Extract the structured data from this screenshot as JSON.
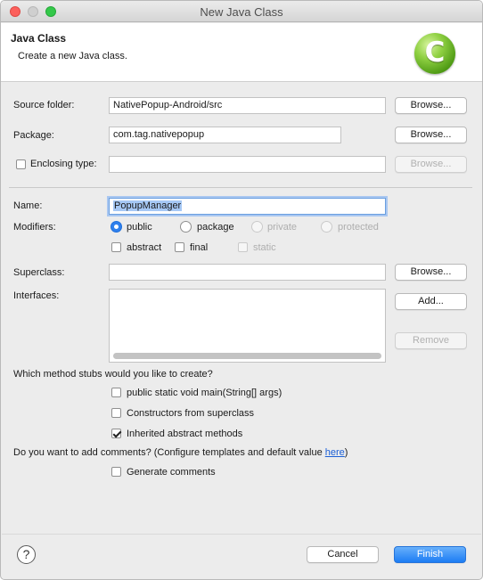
{
  "window": {
    "title": "New Java Class"
  },
  "header": {
    "title": "Java Class",
    "description": "Create a new Java class.",
    "logo_letter": "C"
  },
  "source_folder": {
    "label": "Source folder:",
    "value": "NativePopup-Android/src",
    "browse_label": "Browse..."
  },
  "package": {
    "label": "Package:",
    "value": "com.tag.nativepopup",
    "browse_label": "Browse..."
  },
  "enclosing_type": {
    "label": "Enclosing type:",
    "checked": false,
    "value": "",
    "browse_label": "Browse...",
    "browse_enabled": false
  },
  "name": {
    "label": "Name:",
    "value": "PopupManager"
  },
  "modifiers": {
    "label": "Modifiers:",
    "access": [
      {
        "label": "public",
        "selected": true,
        "enabled": true
      },
      {
        "label": "package",
        "selected": false,
        "enabled": true
      },
      {
        "label": "private",
        "selected": false,
        "enabled": false
      },
      {
        "label": "protected",
        "selected": false,
        "enabled": false
      }
    ],
    "flags": [
      {
        "label": "abstract",
        "checked": false,
        "enabled": true
      },
      {
        "label": "final",
        "checked": false,
        "enabled": true
      },
      {
        "label": "static",
        "checked": false,
        "enabled": false
      }
    ]
  },
  "superclass": {
    "label": "Superclass:",
    "value": "",
    "browse_label": "Browse..."
  },
  "interfaces": {
    "label": "Interfaces:",
    "add_label": "Add...",
    "remove_label": "Remove"
  },
  "method_stubs": {
    "question": "Which method stubs would you like to create?",
    "options": [
      {
        "label": "public static void main(String[] args)",
        "checked": false
      },
      {
        "label": "Constructors from superclass",
        "checked": false
      },
      {
        "label": "Inherited abstract methods",
        "checked": true
      }
    ]
  },
  "comments": {
    "question_prefix": "Do you want to add comments? (Configure templates and default value ",
    "link_text": "here",
    "question_suffix": ")",
    "option_label": "Generate comments",
    "checked": false
  },
  "footer": {
    "help_glyph": "?",
    "cancel_label": "Cancel",
    "finish_label": "Finish"
  },
  "colors": {
    "accent": "#1c7cf4",
    "selection": "#a6c8f5",
    "logo_green": "#4e9a14"
  }
}
